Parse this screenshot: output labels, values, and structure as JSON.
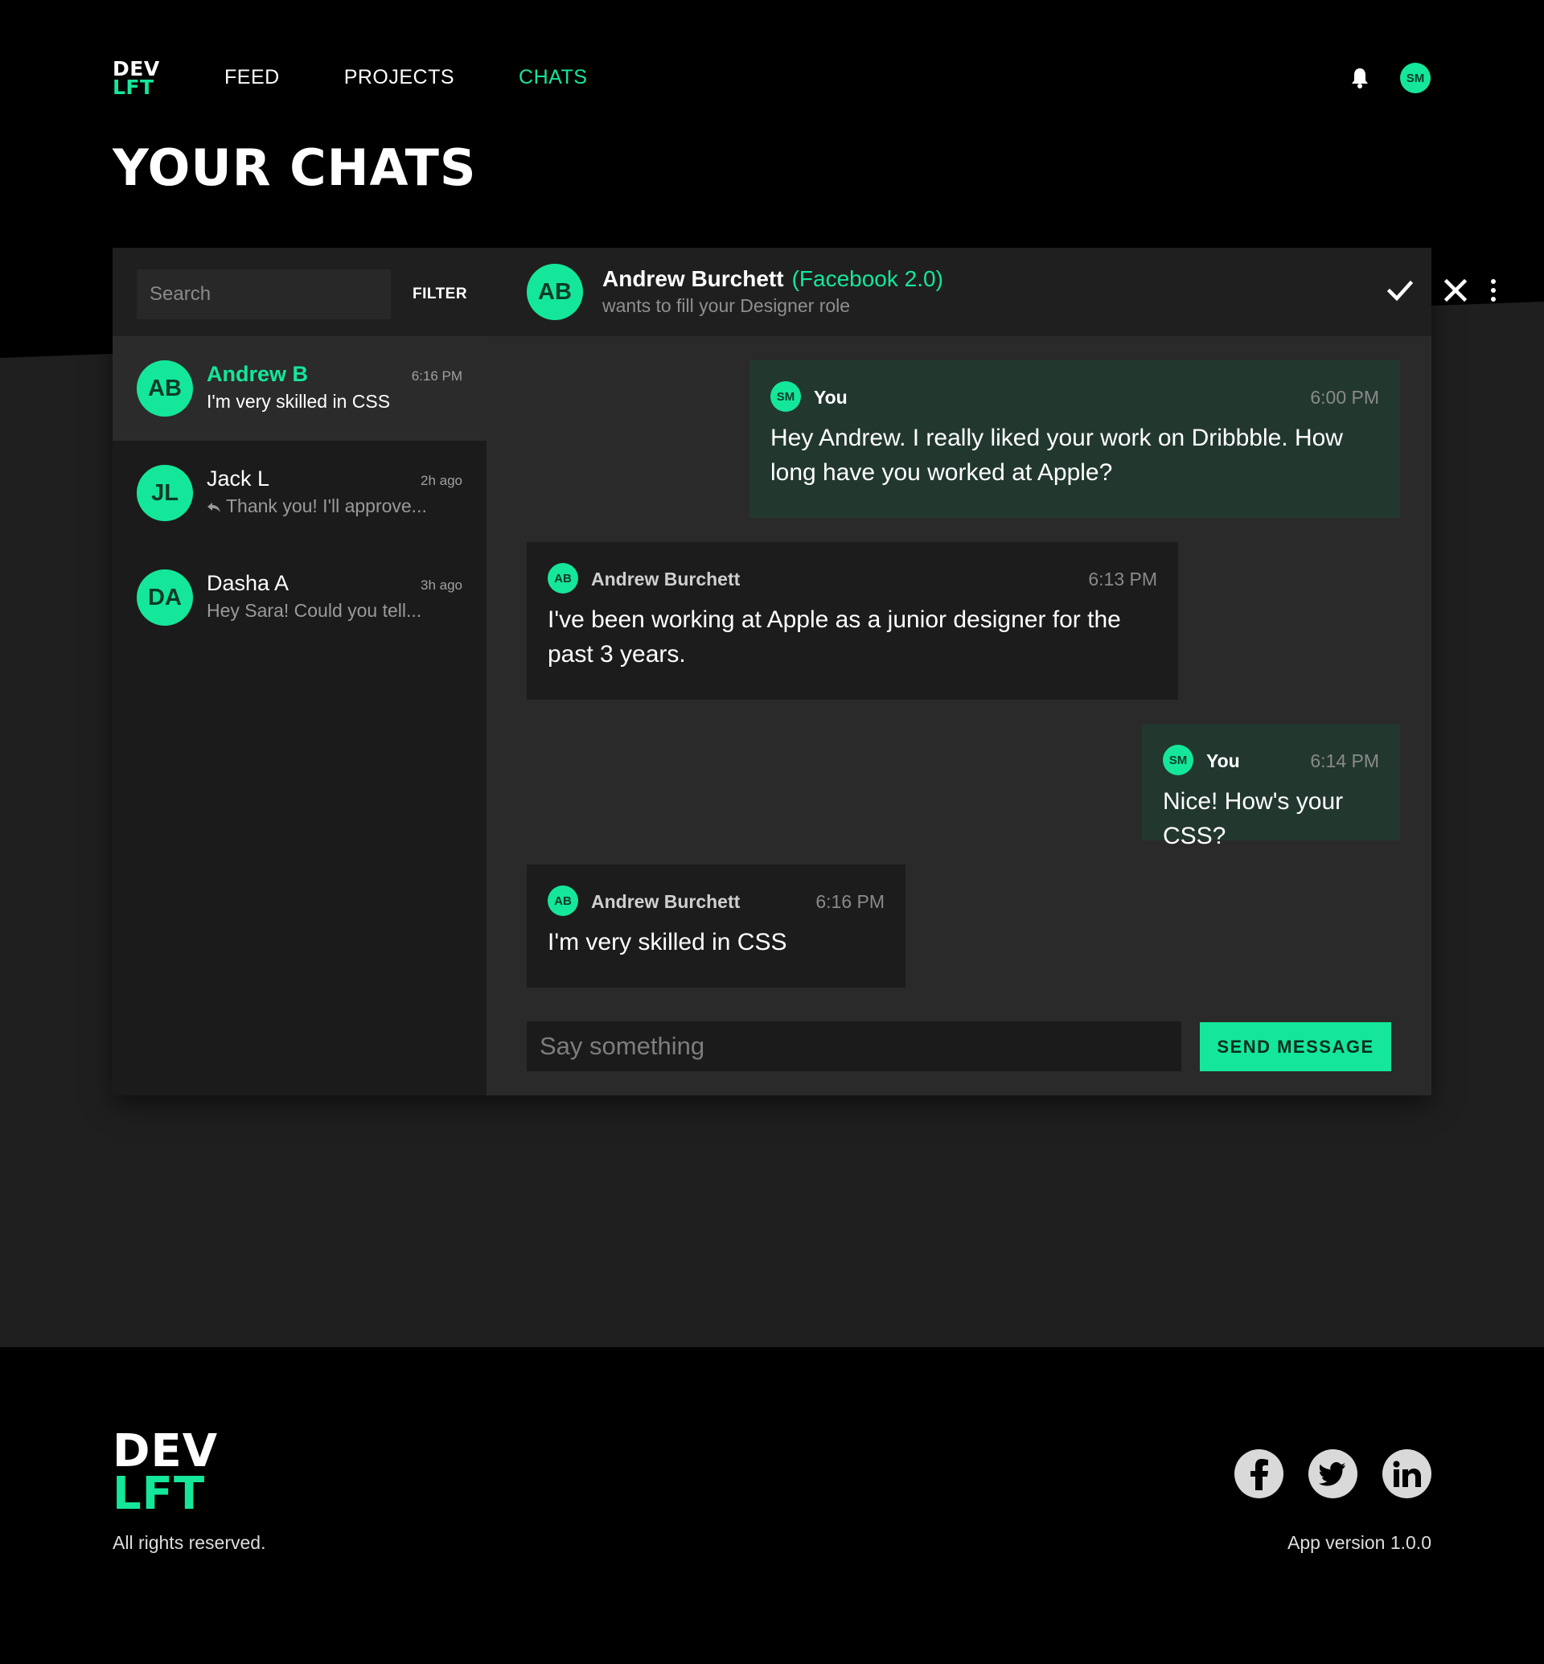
{
  "header": {
    "logo_line1": "DEV",
    "logo_line2": "LFT",
    "nav": [
      {
        "label": "FEED",
        "active": false
      },
      {
        "label": "PROJECTS",
        "active": false
      },
      {
        "label": "CHATS",
        "active": true
      }
    ],
    "bell_icon": "bell-icon",
    "user_initials": "SM"
  },
  "page_title": "YOUR CHATS",
  "sidebar": {
    "search_placeholder": "Search",
    "filter_label": "FILTER",
    "conversations": [
      {
        "initials": "AB",
        "name": "Andrew B",
        "time": "6:16 PM",
        "preview": "I'm very skilled in CSS",
        "selected": true,
        "replied": false
      },
      {
        "initials": "JL",
        "name": "Jack L",
        "time": "2h ago",
        "preview": "Thank you! I'll approve...",
        "selected": false,
        "replied": true
      },
      {
        "initials": "DA",
        "name": "Dasha A",
        "time": "3h ago",
        "preview": "Hey Sara! Could you tell...",
        "selected": false,
        "replied": false
      }
    ]
  },
  "chat": {
    "contact_initials": "AB",
    "contact_name": "Andrew Burchett",
    "contact_company": "(Facebook 2.0)",
    "contact_subtitle": "wants to fill your Designer role",
    "actions": [
      "check-icon",
      "close-icon",
      "more-vertical-icon"
    ],
    "messages": [
      {
        "from": "you",
        "initials": "SM",
        "sender": "You",
        "time": "6:00 PM",
        "text": "Hey Andrew. I really liked your work on Dribbble. How long have you worked at Apple?"
      },
      {
        "from": "them",
        "initials": "AB",
        "sender": "Andrew Burchett",
        "time": "6:13 PM",
        "text": "I've been working at Apple as a junior designer for the past 3 years."
      },
      {
        "from": "you",
        "initials": "SM",
        "sender": "You",
        "time": "6:14 PM",
        "text": "Nice! How's your CSS?"
      },
      {
        "from": "them",
        "initials": "AB",
        "sender": "Andrew Burchett",
        "time": "6:16 PM",
        "text": "I'm very skilled in CSS"
      }
    ],
    "compose_placeholder": "Say something",
    "send_label": "SEND MESSAGE"
  },
  "footer": {
    "logo_line1": "DEV",
    "logo_line2": "LFT",
    "rights": "All rights reserved.",
    "version": "App version 1.0.0",
    "social": [
      "facebook-icon",
      "twitter-icon",
      "linkedin-icon"
    ]
  },
  "colors": {
    "accent": "#14e79a",
    "background": "#1f1f1f",
    "header_background": "#000000",
    "own_message_background": "#22382f",
    "other_message_background": "#1c1c1c"
  }
}
